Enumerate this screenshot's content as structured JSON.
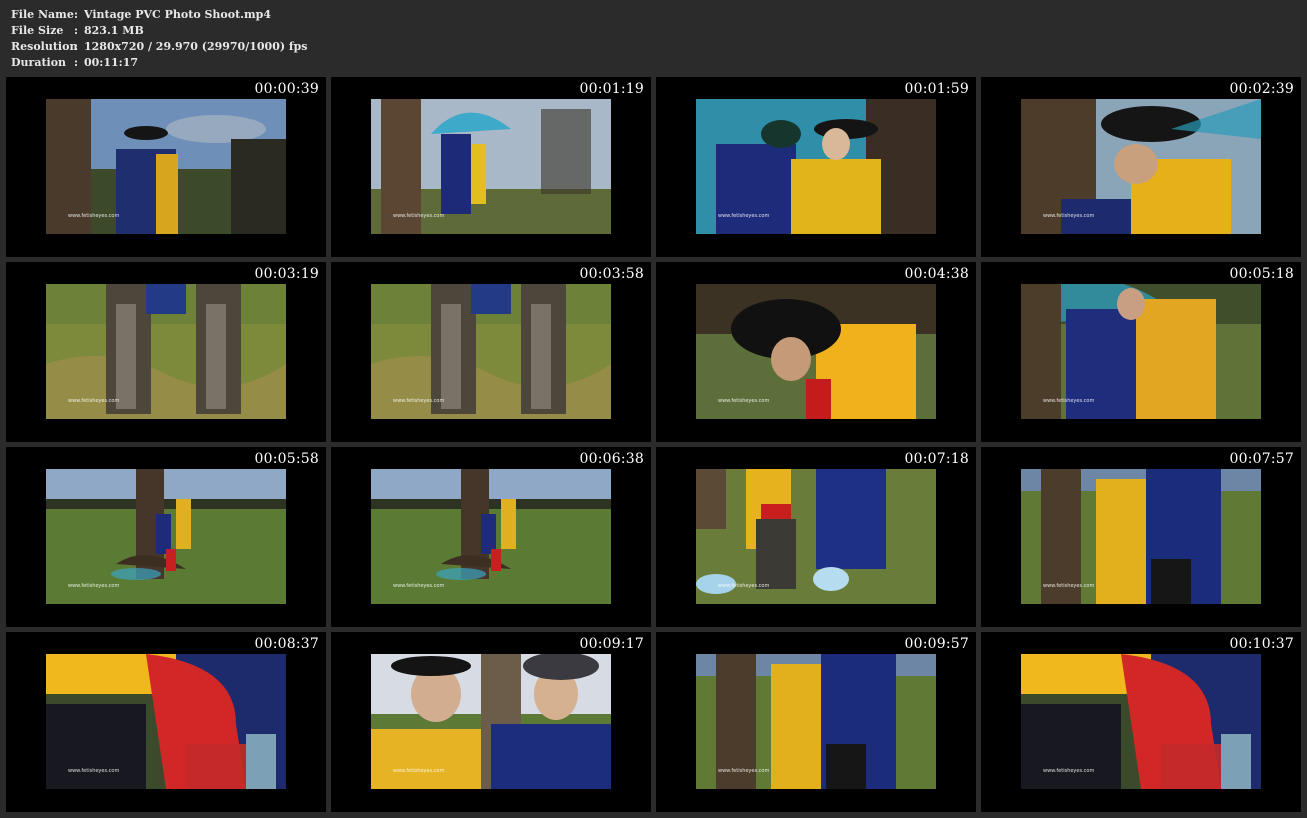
{
  "info": {
    "file_name_label": "File Name",
    "file_name_value": "Vintage PVC Photo Shoot.mp4",
    "file_size_label": "File Size",
    "file_size_value": "823.1 MB",
    "resolution_label": "Resolution",
    "resolution_value": "1280x720 / 29.970 (29970/1000) fps",
    "duration_label": "Duration",
    "duration_value": "00:11:17",
    "separator": ":"
  },
  "watermark": "www.fetisheyes.com",
  "thumbnails": [
    {
      "timestamp": "00:00:39",
      "scene": "sky-tree"
    },
    {
      "timestamp": "00:01:19",
      "scene": "sky-tree-umbrella"
    },
    {
      "timestamp": "00:01:59",
      "scene": "closeup-umbrella"
    },
    {
      "timestamp": "00:02:39",
      "scene": "closeup-hat"
    },
    {
      "timestamp": "00:03:19",
      "scene": "boots-grass"
    },
    {
      "timestamp": "00:03:58",
      "scene": "boots-grass"
    },
    {
      "timestamp": "00:04:38",
      "scene": "hat-field"
    },
    {
      "timestamp": "00:05:18",
      "scene": "embrace-field"
    },
    {
      "timestamp": "00:05:58",
      "scene": "wide-field"
    },
    {
      "timestamp": "00:06:38",
      "scene": "wide-field"
    },
    {
      "timestamp": "00:07:18",
      "scene": "boots-legs"
    },
    {
      "timestamp": "00:07:57",
      "scene": "coats-field"
    },
    {
      "timestamp": "00:08:37",
      "scene": "red-closeup"
    },
    {
      "timestamp": "00:09:17",
      "scene": "portrait-pair"
    },
    {
      "timestamp": "00:09:57",
      "scene": "coats-field"
    },
    {
      "timestamp": "00:10:37",
      "scene": "red-closeup"
    }
  ]
}
